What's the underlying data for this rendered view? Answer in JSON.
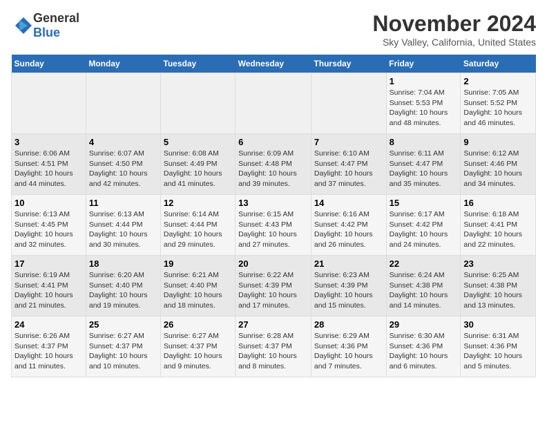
{
  "header": {
    "logo_general": "General",
    "logo_blue": "Blue",
    "title": "November 2024",
    "subtitle": "Sky Valley, California, United States"
  },
  "calendar": {
    "days_of_week": [
      "Sunday",
      "Monday",
      "Tuesday",
      "Wednesday",
      "Thursday",
      "Friday",
      "Saturday"
    ],
    "weeks": [
      [
        {
          "day": "",
          "info": ""
        },
        {
          "day": "",
          "info": ""
        },
        {
          "day": "",
          "info": ""
        },
        {
          "day": "",
          "info": ""
        },
        {
          "day": "",
          "info": ""
        },
        {
          "day": "1",
          "info": "Sunrise: 7:04 AM\nSunset: 5:53 PM\nDaylight: 10 hours and 48 minutes."
        },
        {
          "day": "2",
          "info": "Sunrise: 7:05 AM\nSunset: 5:52 PM\nDaylight: 10 hours and 46 minutes."
        }
      ],
      [
        {
          "day": "3",
          "info": "Sunrise: 6:06 AM\nSunset: 4:51 PM\nDaylight: 10 hours and 44 minutes."
        },
        {
          "day": "4",
          "info": "Sunrise: 6:07 AM\nSunset: 4:50 PM\nDaylight: 10 hours and 42 minutes."
        },
        {
          "day": "5",
          "info": "Sunrise: 6:08 AM\nSunset: 4:49 PM\nDaylight: 10 hours and 41 minutes."
        },
        {
          "day": "6",
          "info": "Sunrise: 6:09 AM\nSunset: 4:48 PM\nDaylight: 10 hours and 39 minutes."
        },
        {
          "day": "7",
          "info": "Sunrise: 6:10 AM\nSunset: 4:47 PM\nDaylight: 10 hours and 37 minutes."
        },
        {
          "day": "8",
          "info": "Sunrise: 6:11 AM\nSunset: 4:47 PM\nDaylight: 10 hours and 35 minutes."
        },
        {
          "day": "9",
          "info": "Sunrise: 6:12 AM\nSunset: 4:46 PM\nDaylight: 10 hours and 34 minutes."
        }
      ],
      [
        {
          "day": "10",
          "info": "Sunrise: 6:13 AM\nSunset: 4:45 PM\nDaylight: 10 hours and 32 minutes."
        },
        {
          "day": "11",
          "info": "Sunrise: 6:13 AM\nSunset: 4:44 PM\nDaylight: 10 hours and 30 minutes."
        },
        {
          "day": "12",
          "info": "Sunrise: 6:14 AM\nSunset: 4:44 PM\nDaylight: 10 hours and 29 minutes."
        },
        {
          "day": "13",
          "info": "Sunrise: 6:15 AM\nSunset: 4:43 PM\nDaylight: 10 hours and 27 minutes."
        },
        {
          "day": "14",
          "info": "Sunrise: 6:16 AM\nSunset: 4:42 PM\nDaylight: 10 hours and 26 minutes."
        },
        {
          "day": "15",
          "info": "Sunrise: 6:17 AM\nSunset: 4:42 PM\nDaylight: 10 hours and 24 minutes."
        },
        {
          "day": "16",
          "info": "Sunrise: 6:18 AM\nSunset: 4:41 PM\nDaylight: 10 hours and 22 minutes."
        }
      ],
      [
        {
          "day": "17",
          "info": "Sunrise: 6:19 AM\nSunset: 4:41 PM\nDaylight: 10 hours and 21 minutes."
        },
        {
          "day": "18",
          "info": "Sunrise: 6:20 AM\nSunset: 4:40 PM\nDaylight: 10 hours and 19 minutes."
        },
        {
          "day": "19",
          "info": "Sunrise: 6:21 AM\nSunset: 4:40 PM\nDaylight: 10 hours and 18 minutes."
        },
        {
          "day": "20",
          "info": "Sunrise: 6:22 AM\nSunset: 4:39 PM\nDaylight: 10 hours and 17 minutes."
        },
        {
          "day": "21",
          "info": "Sunrise: 6:23 AM\nSunset: 4:39 PM\nDaylight: 10 hours and 15 minutes."
        },
        {
          "day": "22",
          "info": "Sunrise: 6:24 AM\nSunset: 4:38 PM\nDaylight: 10 hours and 14 minutes."
        },
        {
          "day": "23",
          "info": "Sunrise: 6:25 AM\nSunset: 4:38 PM\nDaylight: 10 hours and 13 minutes."
        }
      ],
      [
        {
          "day": "24",
          "info": "Sunrise: 6:26 AM\nSunset: 4:37 PM\nDaylight: 10 hours and 11 minutes."
        },
        {
          "day": "25",
          "info": "Sunrise: 6:27 AM\nSunset: 4:37 PM\nDaylight: 10 hours and 10 minutes."
        },
        {
          "day": "26",
          "info": "Sunrise: 6:27 AM\nSunset: 4:37 PM\nDaylight: 10 hours and 9 minutes."
        },
        {
          "day": "27",
          "info": "Sunrise: 6:28 AM\nSunset: 4:37 PM\nDaylight: 10 hours and 8 minutes."
        },
        {
          "day": "28",
          "info": "Sunrise: 6:29 AM\nSunset: 4:36 PM\nDaylight: 10 hours and 7 minutes."
        },
        {
          "day": "29",
          "info": "Sunrise: 6:30 AM\nSunset: 4:36 PM\nDaylight: 10 hours and 6 minutes."
        },
        {
          "day": "30",
          "info": "Sunrise: 6:31 AM\nSunset: 4:36 PM\nDaylight: 10 hours and 5 minutes."
        }
      ]
    ]
  }
}
